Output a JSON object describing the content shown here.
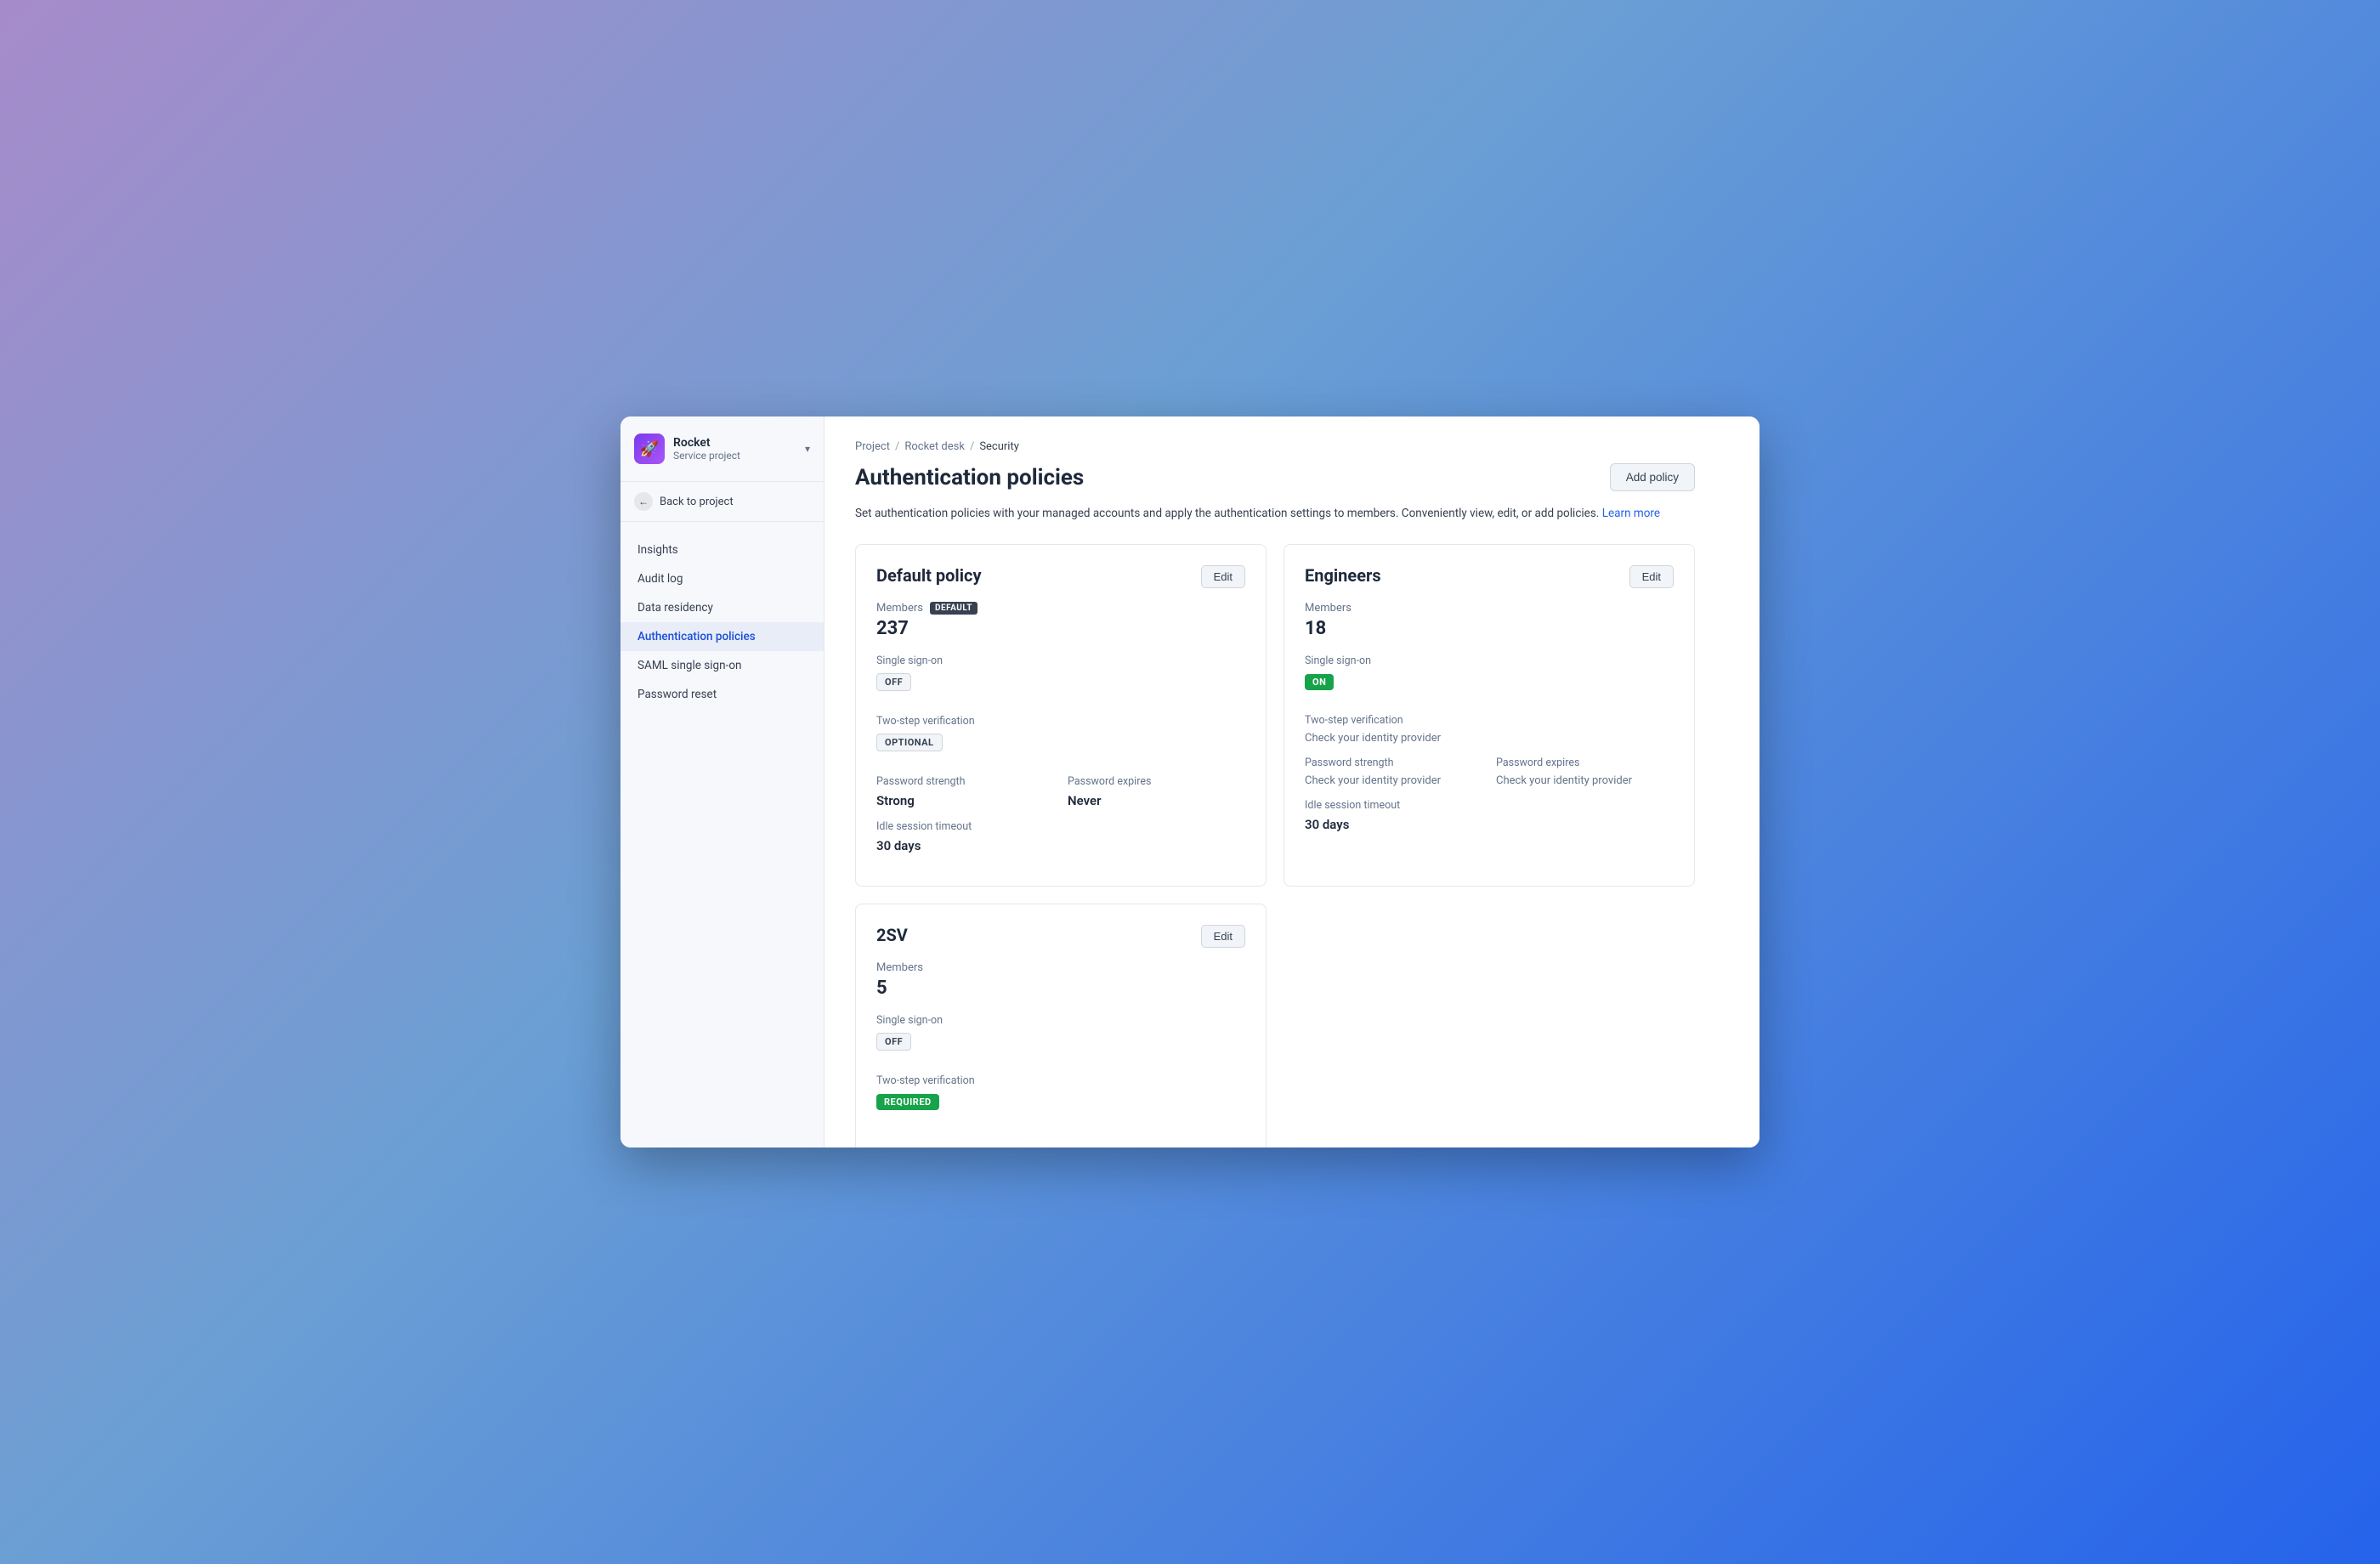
{
  "sidebar": {
    "logo_emoji": "🚀",
    "project_name": "Rocket",
    "project_subtitle": "Service project",
    "back_label": "Back to project",
    "nav_items": [
      {
        "id": "insights",
        "label": "Insights",
        "active": false
      },
      {
        "id": "audit-log",
        "label": "Audit log",
        "active": false
      },
      {
        "id": "data-residency",
        "label": "Data residency",
        "active": false
      },
      {
        "id": "auth-policies",
        "label": "Authentication policies",
        "active": true
      },
      {
        "id": "saml-sso",
        "label": "SAML single sign-on",
        "active": false
      },
      {
        "id": "password-reset",
        "label": "Password reset",
        "active": false
      }
    ]
  },
  "breadcrumb": {
    "items": [
      "Project",
      "Rocket desk",
      "Security"
    ]
  },
  "page": {
    "title": "Authentication policies",
    "add_button_label": "Add policy",
    "description": "Set authentication policies with your managed accounts and apply the authentication settings to members. Conveniently view, edit, or add policies.",
    "learn_more_label": "Learn more"
  },
  "policies": [
    {
      "id": "default",
      "title": "Default policy",
      "edit_label": "Edit",
      "members_label": "Members",
      "members_badge": "DEFAULT",
      "members_count": "237",
      "sso_label": "Single sign-on",
      "sso_status": "OFF",
      "sso_badge_type": "off",
      "two_step_label": "Two-step verification",
      "two_step_status": "OPTIONAL",
      "two_step_badge_type": "optional",
      "password_strength_label": "Password strength",
      "password_strength_value": "Strong",
      "password_expires_label": "Password expires",
      "password_expires_value": "Never",
      "idle_session_label": "Idle session timeout",
      "idle_session_value": "30 days"
    },
    {
      "id": "engineers",
      "title": "Engineers",
      "edit_label": "Edit",
      "members_label": "Members",
      "members_badge": null,
      "members_count": "18",
      "sso_label": "Single sign-on",
      "sso_status": "ON",
      "sso_badge_type": "on",
      "two_step_label": "Two-step verification",
      "two_step_value_text": "Check your identity provider",
      "two_step_badge_type": null,
      "password_strength_label": "Password strength",
      "password_strength_value": "Check your identity provider",
      "password_expires_label": "Password expires",
      "password_expires_value": "Check your identity provider",
      "idle_session_label": "Idle session timeout",
      "idle_session_value": "30 days"
    },
    {
      "id": "2sv",
      "title": "2SV",
      "edit_label": "Edit",
      "members_label": "Members",
      "members_badge": null,
      "members_count": "5",
      "sso_label": "Single sign-on",
      "sso_status": "OFF",
      "sso_badge_type": "off",
      "two_step_label": "Two-step verification",
      "two_step_status": "REQUIRED",
      "two_step_badge_type": "required"
    }
  ]
}
